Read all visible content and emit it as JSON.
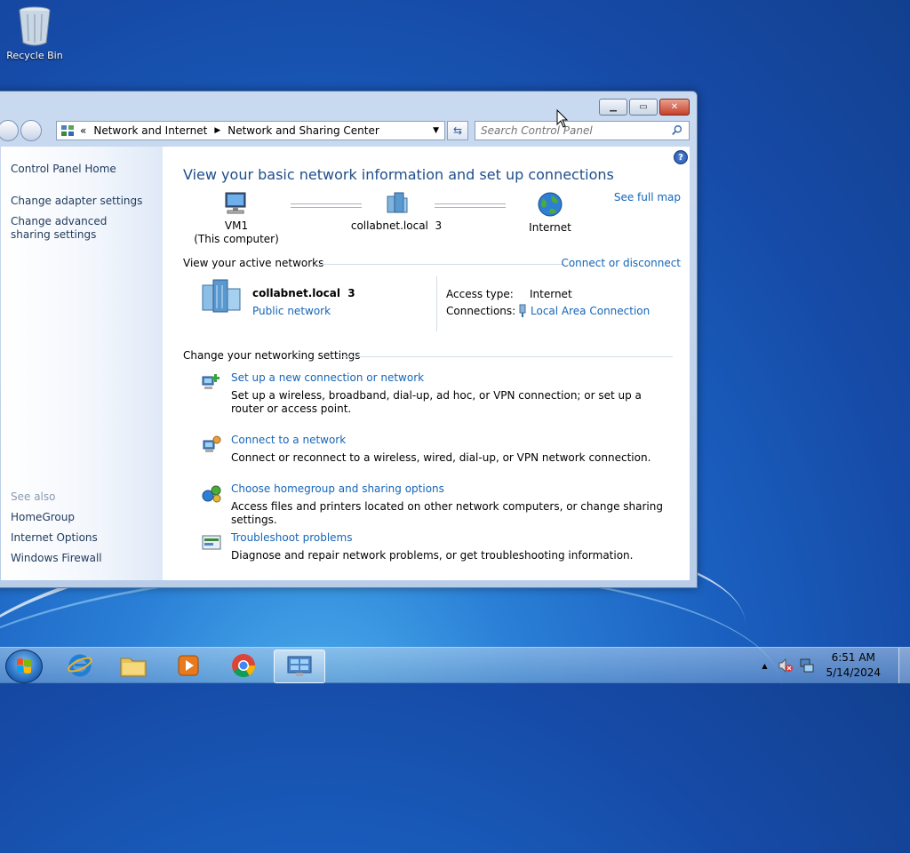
{
  "desktop": {
    "recycle_bin_label": "Recycle Bin"
  },
  "window": {
    "caption_buttons": {
      "minimize": "▁",
      "maximize": "▭",
      "close": "✕"
    },
    "address": {
      "overflow": "«",
      "crumbs": [
        "Network and Internet",
        "Network and Sharing Center"
      ]
    },
    "search_placeholder": "Search Control Panel"
  },
  "sidebar": {
    "home": "Control Panel Home",
    "change_adapter": "Change adapter settings",
    "change_sharing": "Change advanced sharing settings",
    "see_also": "See also",
    "homegroup": "HomeGroup",
    "internet_options": "Internet Options",
    "firewall": "Windows Firewall"
  },
  "main": {
    "help": "?",
    "title": "View your basic network information and set up connections",
    "see_full_map": "See full map",
    "map": {
      "computer_name": "VM1",
      "computer_sub": "(This computer)",
      "network_name": "collabnet.local  3",
      "internet": "Internet"
    },
    "active_networks_header": "View your active networks",
    "connect_disconnect": "Connect or disconnect",
    "active_network": {
      "name": "collabnet.local  3",
      "type": "Public network",
      "access_type_label": "Access type:",
      "access_type_value": "Internet",
      "connections_label": "Connections:",
      "connections_value": "Local Area Connection"
    },
    "change_settings_header": "Change your networking settings",
    "tasks": [
      {
        "title": "Set up a new connection or network",
        "desc": "Set up a wireless, broadband, dial-up, ad hoc, or VPN connection; or set up a router or access point."
      },
      {
        "title": "Connect to a network",
        "desc": "Connect or reconnect to a wireless, wired, dial-up, or VPN network connection."
      },
      {
        "title": "Choose homegroup and sharing options",
        "desc": "Access files and printers located on other network computers, or change sharing settings."
      },
      {
        "title": "Troubleshoot problems",
        "desc": "Diagnose and repair network problems, or get troubleshooting information."
      }
    ]
  },
  "taskbar": {
    "tray_arrow": "▲",
    "time": "6:51 AM",
    "date": "5/14/2024"
  }
}
